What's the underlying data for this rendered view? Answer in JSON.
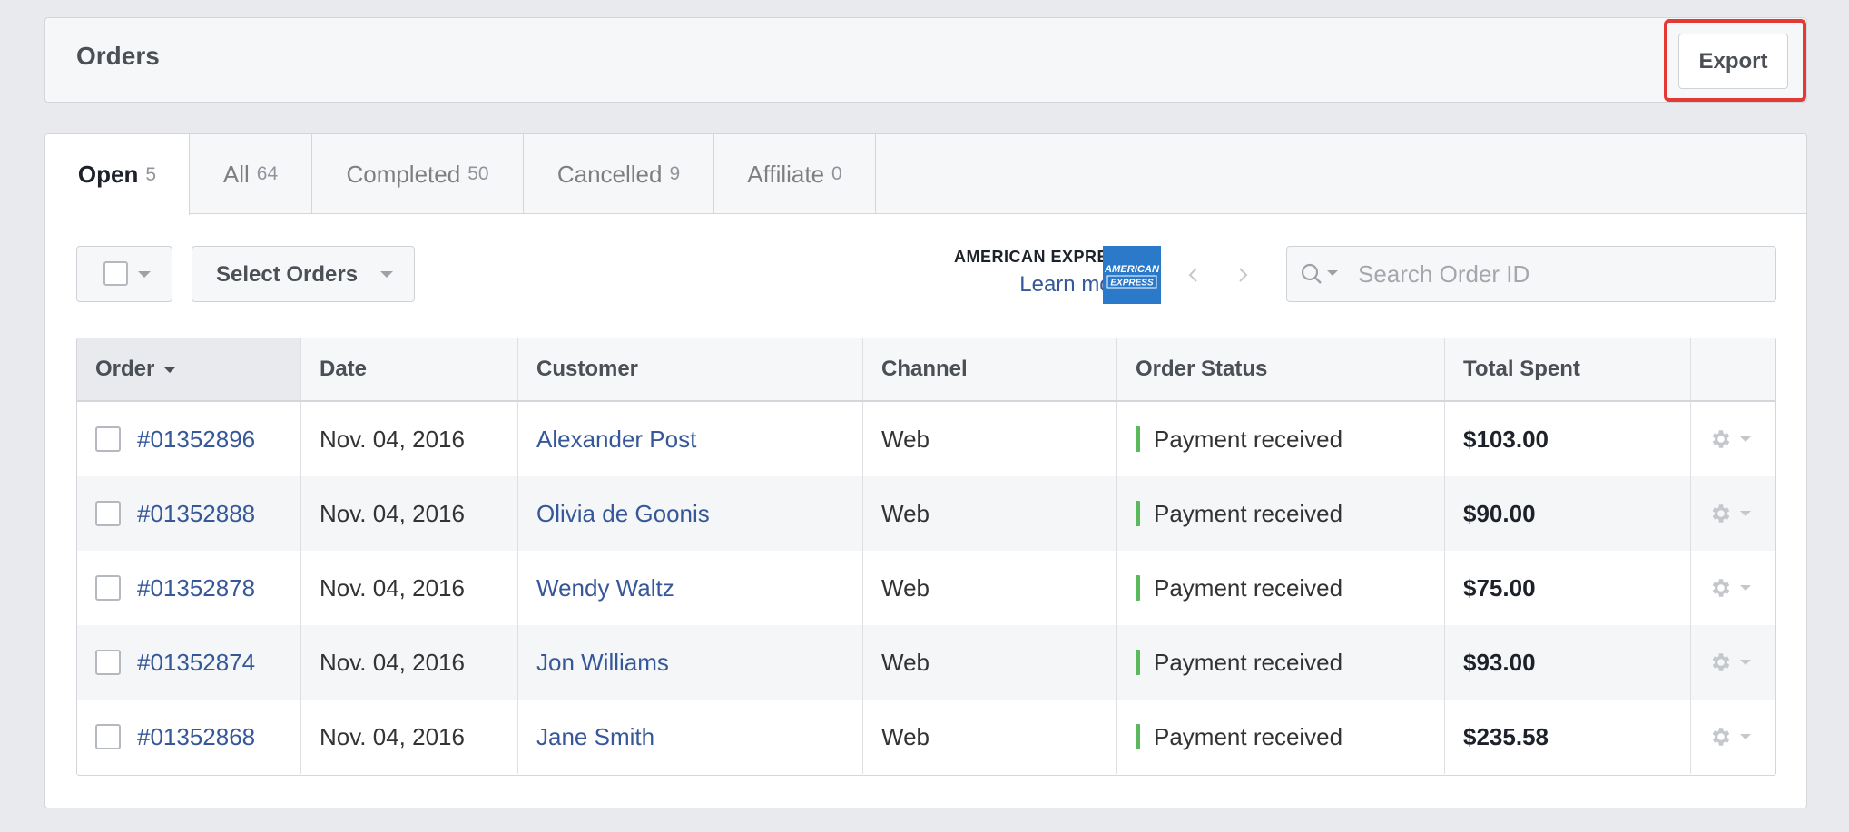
{
  "header": {
    "title": "Orders",
    "export_label": "Export"
  },
  "tabs": [
    {
      "label": "Open",
      "count": "5"
    },
    {
      "label": "All",
      "count": "64"
    },
    {
      "label": "Completed",
      "count": "50"
    },
    {
      "label": "Cancelled",
      "count": "9"
    },
    {
      "label": "Affiliate",
      "count": "0"
    }
  ],
  "toolbar": {
    "select_orders_label": "Select Orders",
    "amex_brand": "AMERICAN EXPRESS",
    "amex_learn_more": "Learn more",
    "amex_logo_text": "AMERICAN EXPRESS",
    "search_placeholder": "Search Order ID"
  },
  "table": {
    "columns": [
      "Order",
      "Date",
      "Customer",
      "Channel",
      "Order Status",
      "Total Spent"
    ],
    "rows": [
      {
        "order": "#01352896",
        "date": "Nov. 04, 2016",
        "customer": "Alexander Post",
        "channel": "Web",
        "status": "Payment received",
        "total": "$103.00"
      },
      {
        "order": "#01352888",
        "date": "Nov. 04, 2016",
        "customer": "Olivia de Goonis",
        "channel": "Web",
        "status": "Payment received",
        "total": "$90.00"
      },
      {
        "order": "#01352878",
        "date": "Nov. 04, 2016",
        "customer": "Wendy Waltz",
        "channel": "Web",
        "status": "Payment received",
        "total": "$75.00"
      },
      {
        "order": "#01352874",
        "date": "Nov. 04, 2016",
        "customer": "Jon Williams",
        "channel": "Web",
        "status": "Payment received",
        "total": "$93.00"
      },
      {
        "order": "#01352868",
        "date": "Nov. 04, 2016",
        "customer": "Jane Smith",
        "channel": "Web",
        "status": "Payment received",
        "total": "$235.58"
      }
    ]
  },
  "colors": {
    "link": "#365899",
    "status_paid": "#5cb85c",
    "highlight": "#e53935"
  }
}
